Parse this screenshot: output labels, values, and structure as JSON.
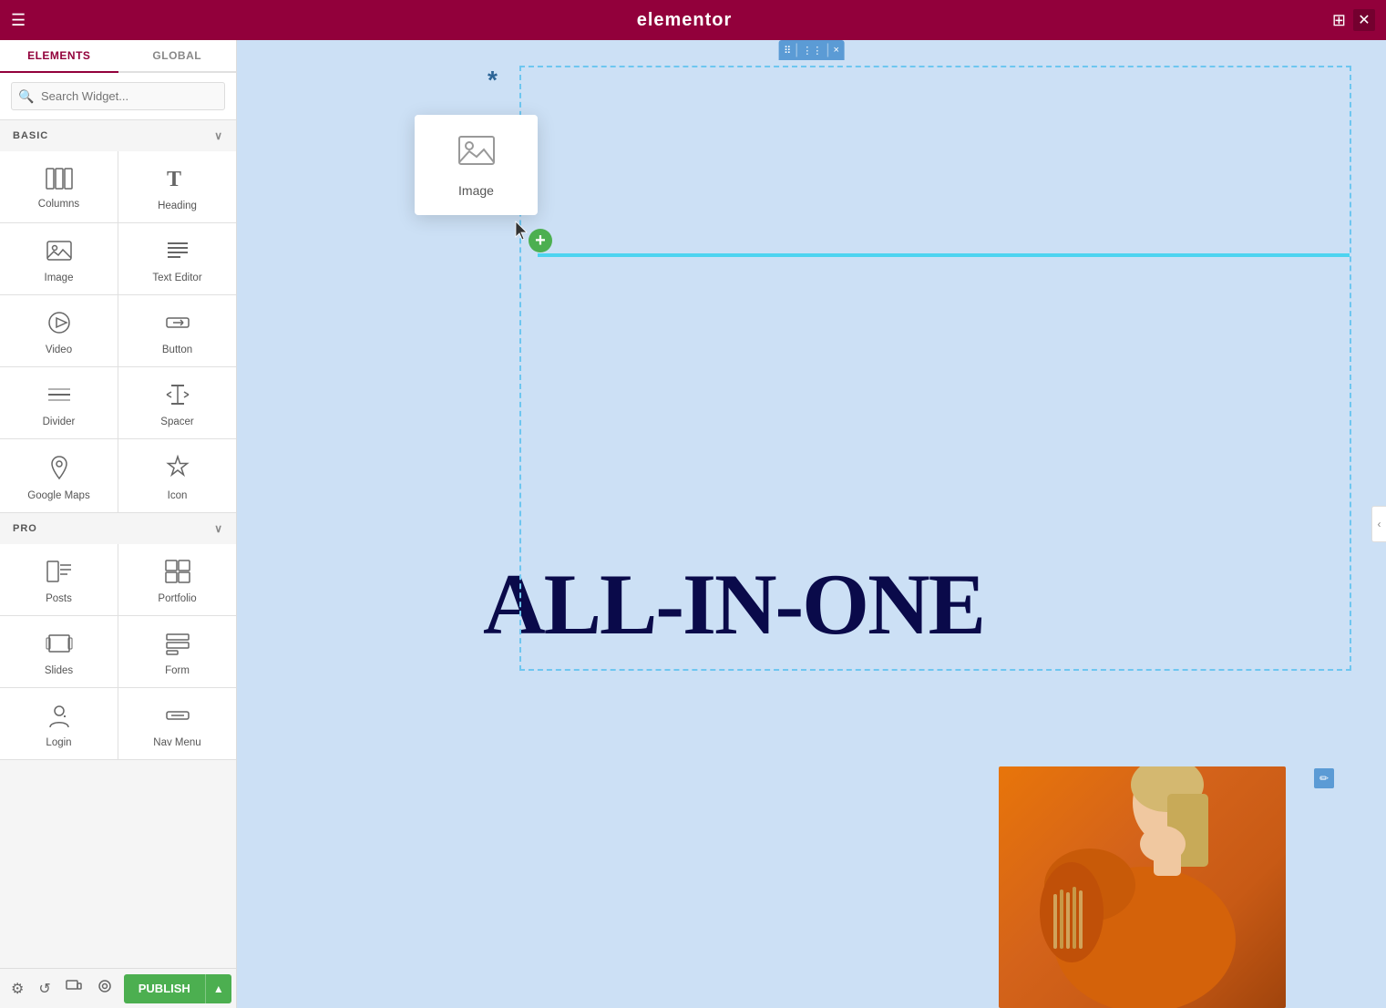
{
  "topbar": {
    "logo": "elementor",
    "hamburger_label": "☰",
    "grid_label": "⊞",
    "close_label": "✕"
  },
  "sidebar": {
    "tab_elements": "ELEMENTS",
    "tab_global": "GLOBAL",
    "search_placeholder": "Search Widget...",
    "section_basic": "BASIC",
    "section_pro": "PRO",
    "basic_widgets": [
      {
        "id": "columns",
        "label": "Columns",
        "icon": "columns"
      },
      {
        "id": "heading",
        "label": "Heading",
        "icon": "heading"
      },
      {
        "id": "image",
        "label": "Image",
        "icon": "image"
      },
      {
        "id": "text-editor",
        "label": "Text Editor",
        "icon": "text-editor"
      },
      {
        "id": "video",
        "label": "Video",
        "icon": "video"
      },
      {
        "id": "button",
        "label": "Button",
        "icon": "button"
      },
      {
        "id": "divider",
        "label": "Divider",
        "icon": "divider"
      },
      {
        "id": "spacer",
        "label": "Spacer",
        "icon": "spacer"
      },
      {
        "id": "google-maps",
        "label": "Google Maps",
        "icon": "google-maps"
      },
      {
        "id": "icon",
        "label": "Icon",
        "icon": "icon"
      }
    ],
    "pro_widgets": [
      {
        "id": "posts",
        "label": "Posts",
        "icon": "posts"
      },
      {
        "id": "portfolio",
        "label": "Portfolio",
        "icon": "portfolio"
      },
      {
        "id": "slides",
        "label": "Slides",
        "icon": "slides"
      },
      {
        "id": "form",
        "label": "Form",
        "icon": "form"
      },
      {
        "id": "login",
        "label": "Login",
        "icon": "login"
      },
      {
        "id": "nav-menu",
        "label": "Nav Menu",
        "icon": "nav-menu"
      }
    ]
  },
  "bottombar": {
    "settings_icon": "⚙",
    "history_icon": "↺",
    "responsive_icon": "📱",
    "preview_icon": "👁",
    "publish_label": "PUBLISH",
    "publish_arrow": "▲"
  },
  "canvas": {
    "asterisk": "*",
    "floating_widget_label": "Image",
    "drop_plus": "+",
    "big_text": "ALL-IN-ONE",
    "section_toolbar": {
      "move": "⠿",
      "sep": "⋮",
      "close": "×"
    },
    "image_edit_icon": "✏"
  }
}
